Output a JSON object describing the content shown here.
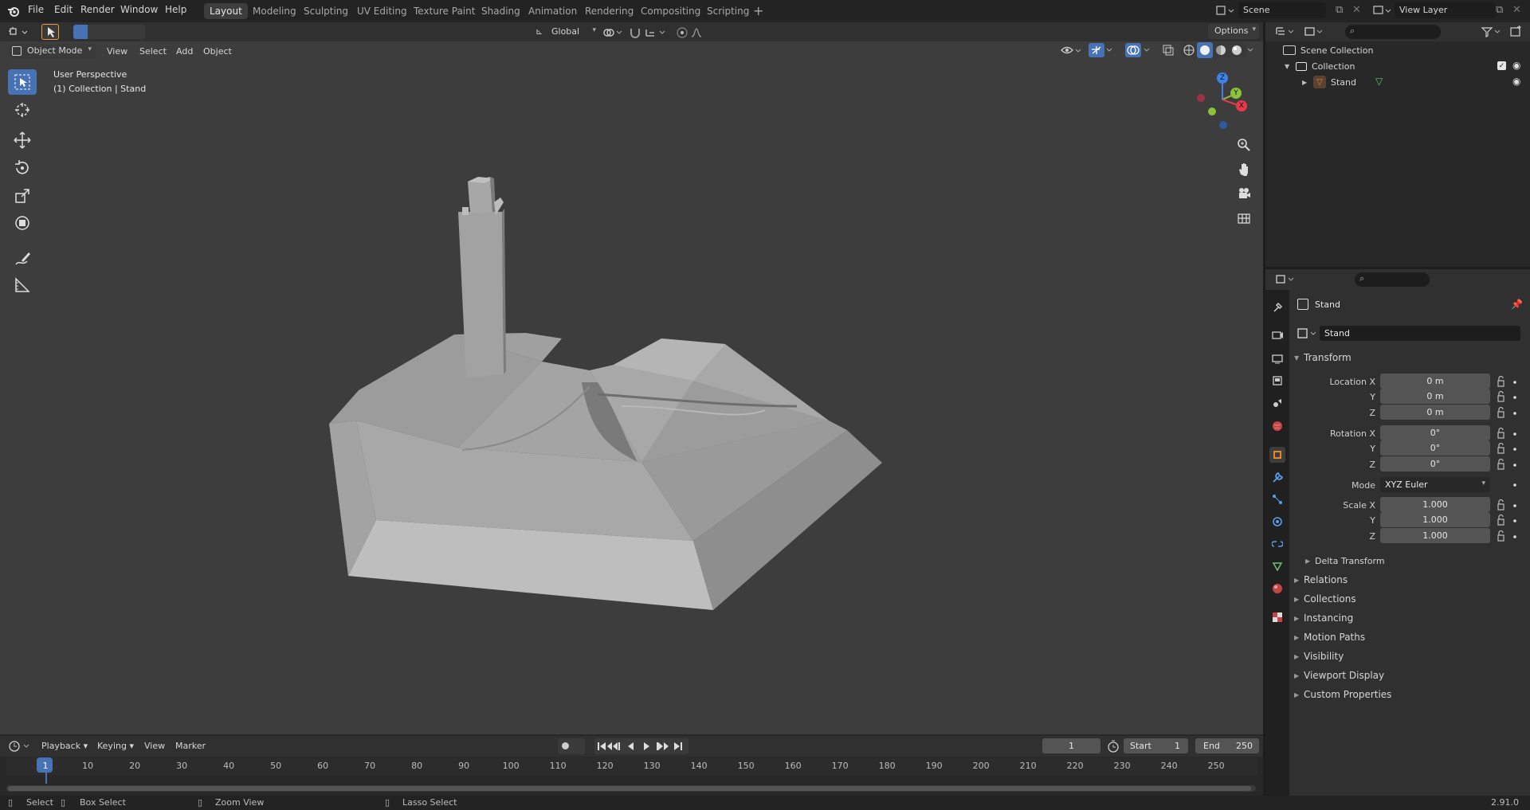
{
  "menu": {
    "items": [
      "File",
      "Edit",
      "Render",
      "Window",
      "Help"
    ]
  },
  "workspaces": [
    {
      "label": "Layout",
      "active": true
    },
    {
      "label": "Modeling"
    },
    {
      "label": "Sculpting"
    },
    {
      "label": "UV Editing"
    },
    {
      "label": "Texture Paint"
    },
    {
      "label": "Shading"
    },
    {
      "label": "Animation"
    },
    {
      "label": "Rendering"
    },
    {
      "label": "Compositing"
    },
    {
      "label": "Scripting"
    }
  ],
  "scene": {
    "name": "Scene",
    "view_layer": "View Layer"
  },
  "viewport": {
    "mode": "Object Mode",
    "menus": [
      "View",
      "Select",
      "Add",
      "Object"
    ],
    "orientation": "Global",
    "options_label": "Options",
    "overlay_title": "User Perspective",
    "overlay_subtitle": "(1) Collection | Stand",
    "gizmo": {
      "x": "X",
      "y": "Y",
      "z": "Z"
    }
  },
  "outliner": {
    "root": "Scene Collection",
    "collection": "Collection",
    "object": "Stand"
  },
  "properties": {
    "object_name": "Stand",
    "data_name": "Stand",
    "transform_label": "Transform",
    "location": {
      "label": "Location X",
      "x": "0 m",
      "y": "0 m",
      "z": "0 m"
    },
    "rotation": {
      "label": "Rotation X",
      "x": "0°",
      "y": "0°",
      "z": "0°"
    },
    "mode": {
      "label": "Mode",
      "value": "XYZ Euler"
    },
    "scale": {
      "label": "Scale X",
      "x": "1.000",
      "y": "1.000",
      "z": "1.000"
    },
    "axis_labels": {
      "y": "Y",
      "z": "Z"
    },
    "delta_transform": "Delta Transform",
    "panels": [
      "Relations",
      "Collections",
      "Instancing",
      "Motion Paths",
      "Visibility",
      "Viewport Display",
      "Custom Properties"
    ]
  },
  "timeline": {
    "menus": [
      "Playback",
      "Keying",
      "View",
      "Marker"
    ],
    "current_frame": "1",
    "start_label": "Start",
    "start": "1",
    "end_label": "End",
    "end": "250",
    "frame_marks": [
      "1",
      "10",
      "20",
      "30",
      "40",
      "50",
      "60",
      "70",
      "80",
      "90",
      "100",
      "110",
      "120",
      "130",
      "140",
      "150",
      "160",
      "170",
      "180",
      "190",
      "200",
      "210",
      "220",
      "230",
      "240",
      "250"
    ]
  },
  "statusbar": {
    "select": "Select",
    "box_select": "Box Select",
    "zoom_view": "Zoom View",
    "lasso_select": "Lasso Select",
    "version": "2.91.0"
  },
  "colors": {
    "accent": "#4772b3",
    "viewport_bg": "#3d3d3d",
    "axis_x": "#e8394b",
    "axis_y": "#8bc33a",
    "axis_z": "#3d83e8",
    "object_orange": "#e8862a"
  }
}
